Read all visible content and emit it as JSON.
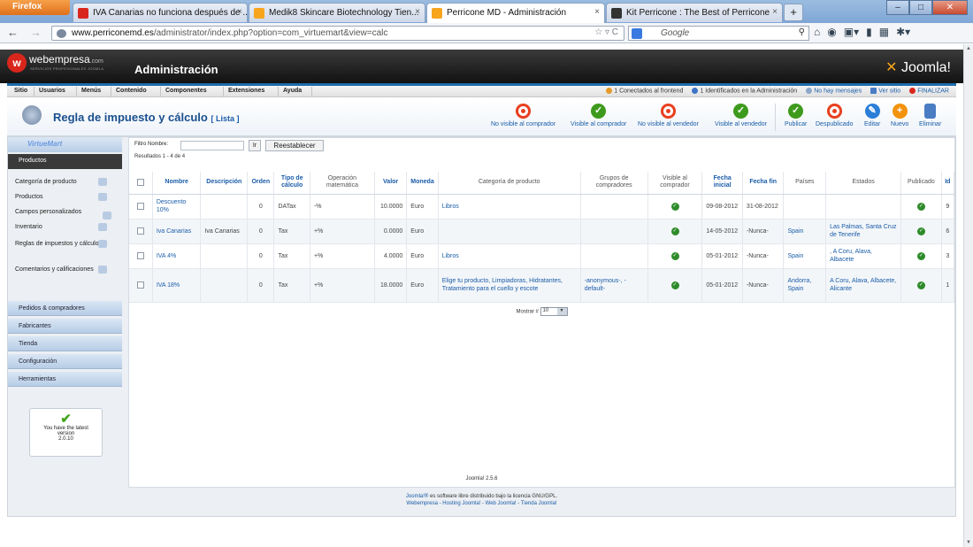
{
  "browser": {
    "menu_label": "Firefox",
    "tabs": [
      {
        "title": "IVA Canarias no funciona después de ...",
        "fav": "#d9261c"
      },
      {
        "title": "Medik8 Skincare Biotechnology Tien...",
        "fav": "#f7a51c"
      },
      {
        "title": "Perricone MD - Administración",
        "fav": "#f7a51c"
      },
      {
        "title": "Kit Perricone : The Best of Perricone",
        "fav": "#333333"
      }
    ],
    "new_tab": "+",
    "url_host": "www.perriconemd.es",
    "url_path": "/administrator/index.php?option=com_virtuemart&view=calc",
    "search_placeholder": "Google"
  },
  "header": {
    "brand": "webempresa",
    "brand_suffix": ".com",
    "brand_sub": "SERVICIOS PROFESIONALES JOOMLA",
    "title": "Administración",
    "joomla_logo": "Joomla!"
  },
  "menu": {
    "items": [
      "Sitio",
      "Usuarios",
      "Menús",
      "Contenido",
      "Componentes",
      "Extensiones",
      "Ayuda"
    ],
    "status": {
      "frontend": "1 Conectados al frontend",
      "admin": "1 Identificados en la Administración",
      "messages": "No hay mensajes",
      "view_site": "Ver sitio",
      "logout": "FINALIZAR"
    }
  },
  "toolbar": {
    "title": "Regla de impuesto y cálculo",
    "subtitle": "[ Lista ]",
    "buttons": [
      {
        "label": "No visible al comprador",
        "icon": "red"
      },
      {
        "label": "Visible al comprador",
        "icon": "green"
      },
      {
        "label": "No visible al vendedor",
        "icon": "red"
      },
      {
        "label": "Visible al vendedor",
        "icon": "green"
      },
      {
        "label": "Publicar",
        "icon": "green"
      },
      {
        "label": "Despublicado",
        "icon": "red"
      },
      {
        "label": "Editar",
        "icon": "blue"
      },
      {
        "label": "Nuevo",
        "icon": "orange"
      },
      {
        "label": "Eliminar",
        "icon": "trash"
      }
    ]
  },
  "sidebar": {
    "logo": "VirtueMart",
    "active_section": "Productos",
    "items": [
      "Categoría de producto",
      "Productos",
      "Campos personalizados",
      "Inventario",
      "Reglas de impuestos y cálculos",
      "Comentarios y calificaciones"
    ],
    "sections": [
      "Pedidos & compradores",
      "Fabricantes",
      "Tienda",
      "Configuración",
      "Herramientas"
    ],
    "version_text": "You have the latest version",
    "version": "2.0.10"
  },
  "filters": {
    "label": "Filtro Nombre:",
    "go": "Ir",
    "reset": "Reestablecer",
    "results": "Resultados 1 - 4 de 4"
  },
  "table": {
    "headers": [
      "Nombre",
      "Descripción",
      "Orden",
      "Tipo de cálculo",
      "Operación matemática",
      "Valor",
      "Moneda",
      "Categoría de producto",
      "Grupos de compradores",
      "Visible al comprador",
      "Fecha inicial",
      "Fecha fin",
      "Países",
      "Estados",
      "Publicado",
      "Id"
    ],
    "rows": [
      {
        "name": "Descuento 10%",
        "desc": "",
        "order": "0",
        "type": "DATax",
        "op": "-%",
        "value": "10.0000",
        "currency": "Euro",
        "category": "Libros",
        "groups": "",
        "start": "09-08-2012",
        "end": "31-08-2012",
        "countries": "",
        "states": "",
        "id": "9"
      },
      {
        "name": "Iva Canarias",
        "desc": "Iva Canarias",
        "order": "0",
        "type": "Tax",
        "op": "+%",
        "value": "0.0000",
        "currency": "Euro",
        "category": "",
        "groups": "",
        "start": "14-05-2012",
        "end": "-Nunca-",
        "countries": "Spain",
        "states": "Las Palmas, Santa Cruz de Tenerife",
        "id": "6"
      },
      {
        "name": "IVA 4%",
        "desc": "",
        "order": "0",
        "type": "Tax",
        "op": "+%",
        "value": "4.0000",
        "currency": "Euro",
        "category": "Libros",
        "groups": "",
        "start": "05-01-2012",
        "end": "-Nunca-",
        "countries": "Spain",
        "states": ", A Coru, Alava, Albacete",
        "id": "3"
      },
      {
        "name": "IVA 18%",
        "desc": "",
        "order": "0",
        "type": "Tax",
        "op": "+%",
        "value": "18.0000",
        "currency": "Euro",
        "category": "Elige tu producto, Limpiadoras, Hidratantes, Tratamiento para el cuello y escote",
        "groups": "-anonymous-, -default-",
        "start": "05-01-2012",
        "end": "-Nunca-",
        "countries": "Andorra, Spain",
        "states": "A Coru, Alava, Albacete, Alicante",
        "id": "1"
      }
    ]
  },
  "pagination": {
    "label": "Mostrar #",
    "value": "10"
  },
  "footer": {
    "version": "Joomla! 2.5.6",
    "license_link": "Joomla!®",
    "license_text": " es software libre distribuido bajo la licencia GNU/GPL.",
    "links": "Webempresa - Hosting Joomla! - Web Joomla! - Tienda Joomla!"
  }
}
